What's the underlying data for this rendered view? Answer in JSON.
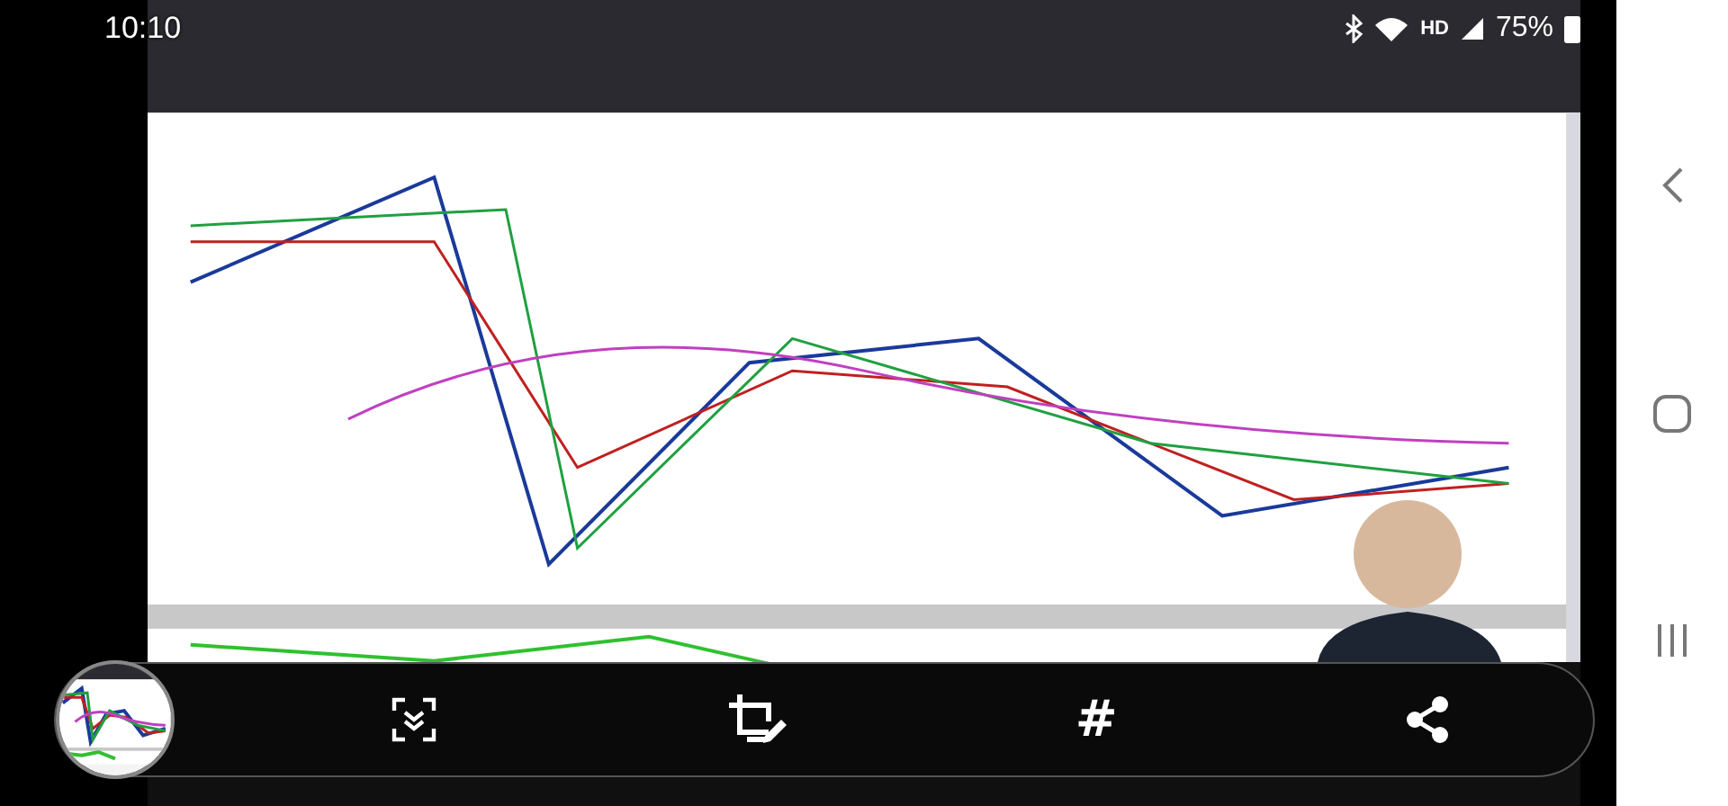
{
  "status_bar": {
    "time": "10:10",
    "network": "HD",
    "battery": "75%"
  },
  "screenshot_toolbar": {
    "actions": [
      {
        "kind": "scroll_capture"
      },
      {
        "kind": "edit"
      },
      {
        "kind": "tag",
        "label": "#"
      },
      {
        "kind": "share"
      }
    ]
  },
  "navigation_bar": {
    "buttons": [
      {
        "kind": "back"
      },
      {
        "kind": "home"
      },
      {
        "kind": "recents"
      }
    ]
  }
}
